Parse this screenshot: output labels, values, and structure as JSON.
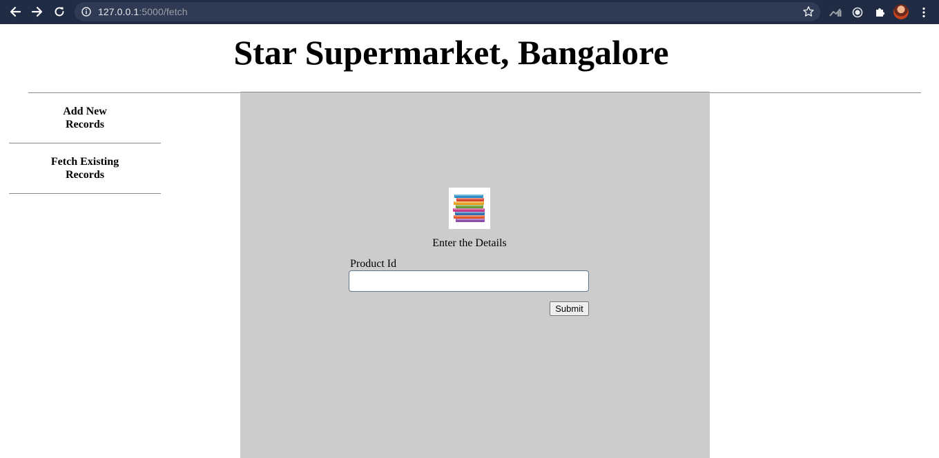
{
  "browser": {
    "url_host": "127.0.0.1",
    "url_path": ":5000/fetch"
  },
  "page": {
    "title": "Star Supermarket, Bangalore"
  },
  "sidebar": {
    "items": [
      {
        "label": "Add New Records"
      },
      {
        "label": "Fetch Existing Records"
      }
    ]
  },
  "form": {
    "icon": "books-stack-icon",
    "heading": "Enter the Details",
    "field_label": "Product Id",
    "field_value": "",
    "submit_label": "Submit"
  },
  "colors": {
    "chrome_bg": "#202c44",
    "panel_bg": "#cccccc"
  }
}
